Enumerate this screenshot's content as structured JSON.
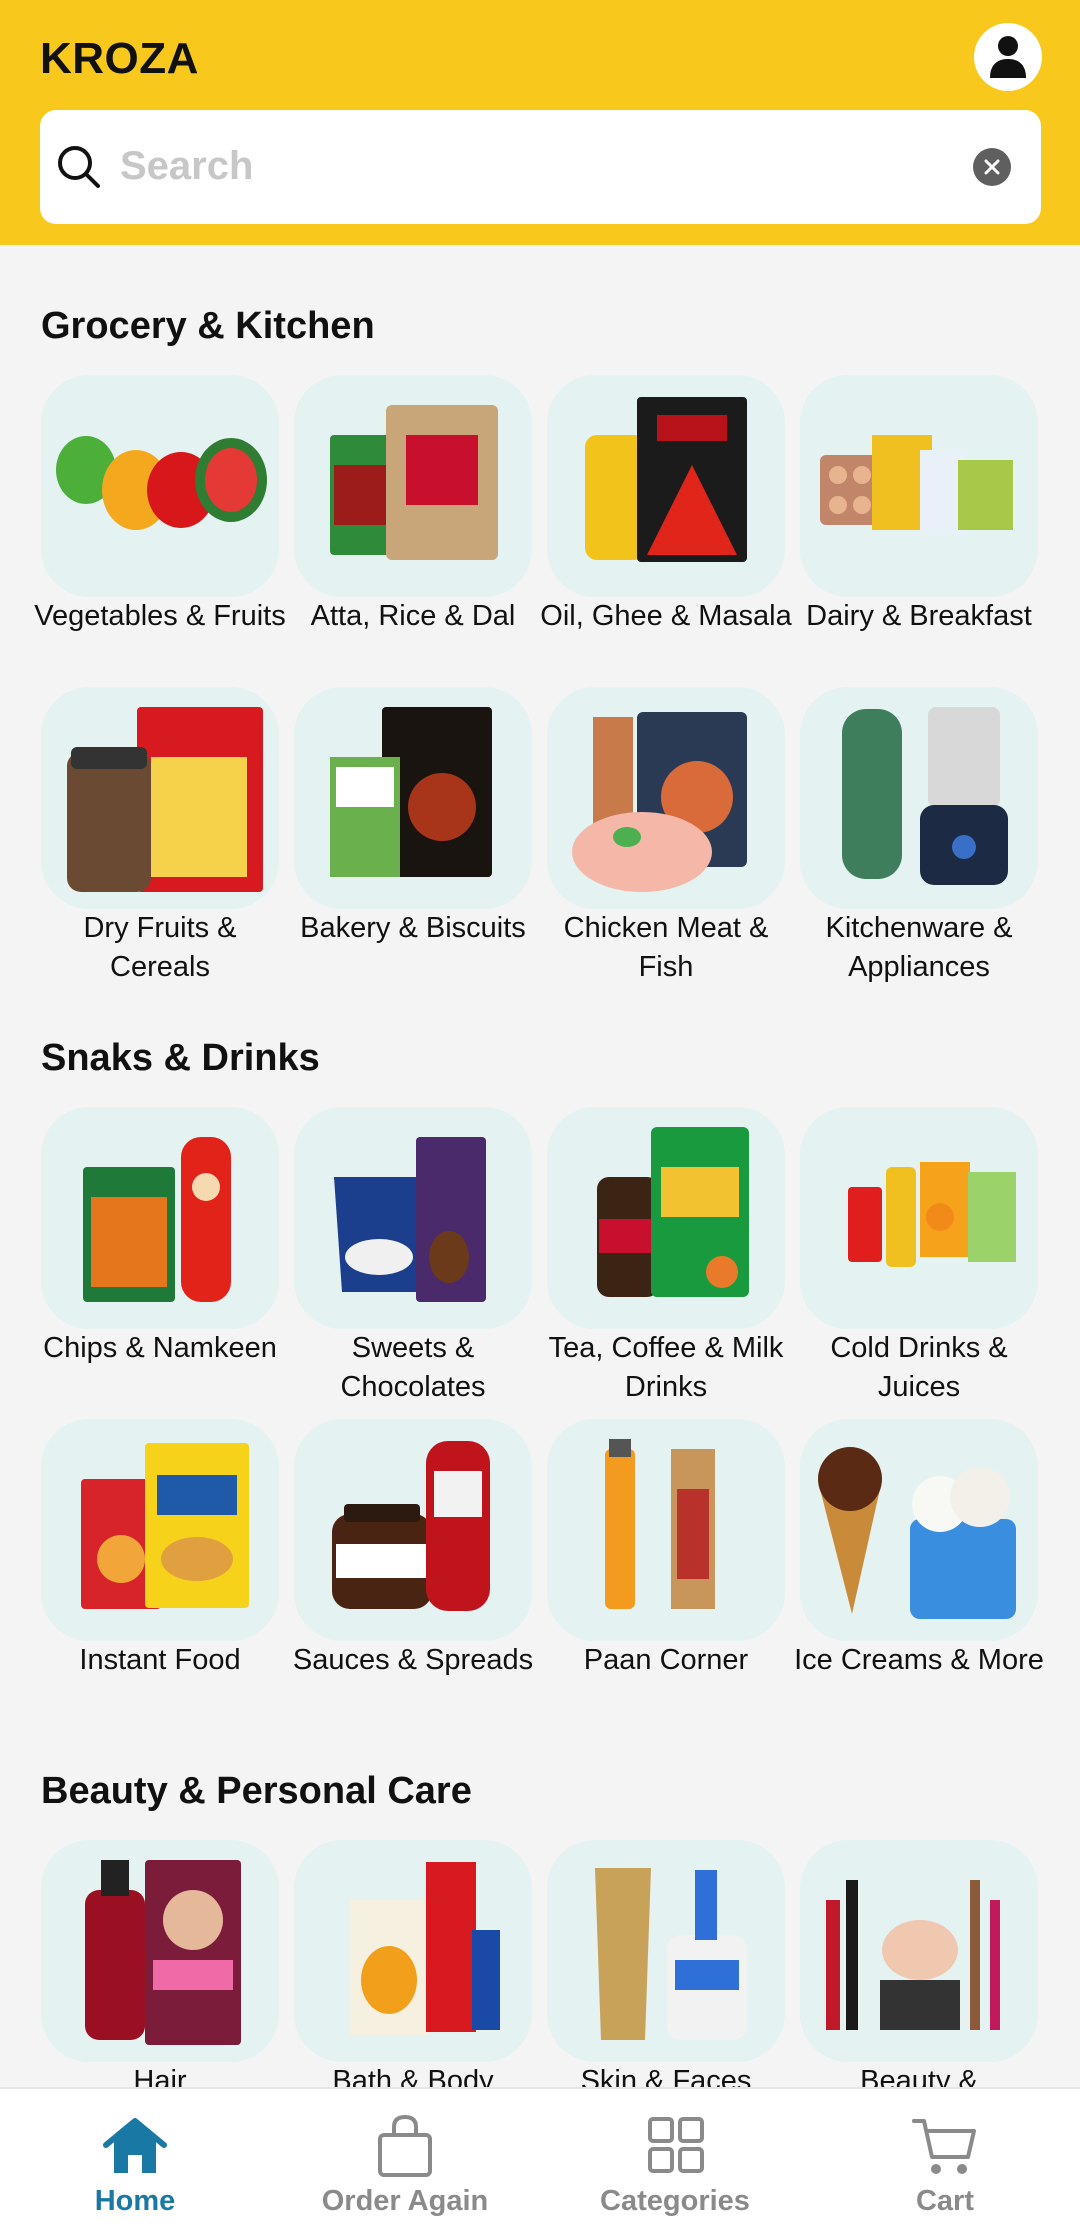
{
  "header": {
    "brand": "KROZA",
    "search": {
      "placeholder": "Search"
    }
  },
  "sections": [
    {
      "title": "Grocery & Kitchen",
      "items": [
        {
          "label": "Vegetables & Fruits"
        },
        {
          "label": "Atta, Rice & Dal"
        },
        {
          "label": "Oil, Ghee & Masala"
        },
        {
          "label": "Dairy & Breakfast"
        },
        {
          "label": "Dry Fruits & Cereals"
        },
        {
          "label": "Bakery & Biscuits"
        },
        {
          "label": "Chicken Meat & Fish"
        },
        {
          "label": "Kitchenware & Appliances"
        }
      ]
    },
    {
      "title": "Snaks & Drinks",
      "items": [
        {
          "label": "Chips & Namkeen"
        },
        {
          "label": "Sweets & Chocolates"
        },
        {
          "label": "Tea, Coffee & Milk Drinks"
        },
        {
          "label": "Cold Drinks & Juices"
        },
        {
          "label": "Instant Food"
        },
        {
          "label": "Sauces & Spreads"
        },
        {
          "label": "Paan Corner"
        },
        {
          "label": "Ice Creams & More"
        }
      ]
    },
    {
      "title": "Beauty & Personal Care",
      "items": [
        {
          "label": "Hair"
        },
        {
          "label": "Bath & Body"
        },
        {
          "label": "Skin & Faces"
        },
        {
          "label": "Beauty &"
        }
      ]
    }
  ],
  "bottom_nav": {
    "items": [
      {
        "label": "Home",
        "icon": "home-icon",
        "active": true
      },
      {
        "label": "Order Again",
        "icon": "shopping-bag-icon",
        "active": false
      },
      {
        "label": "Categories",
        "icon": "grid-icon",
        "active": false
      },
      {
        "label": "Cart",
        "icon": "cart-icon",
        "active": false
      }
    ]
  },
  "colors": {
    "header_bg": "#f8c91c",
    "tile_bg": "#e4f2f2",
    "nav_active": "#1a78a4",
    "nav_inactive": "#8a8a8a"
  }
}
